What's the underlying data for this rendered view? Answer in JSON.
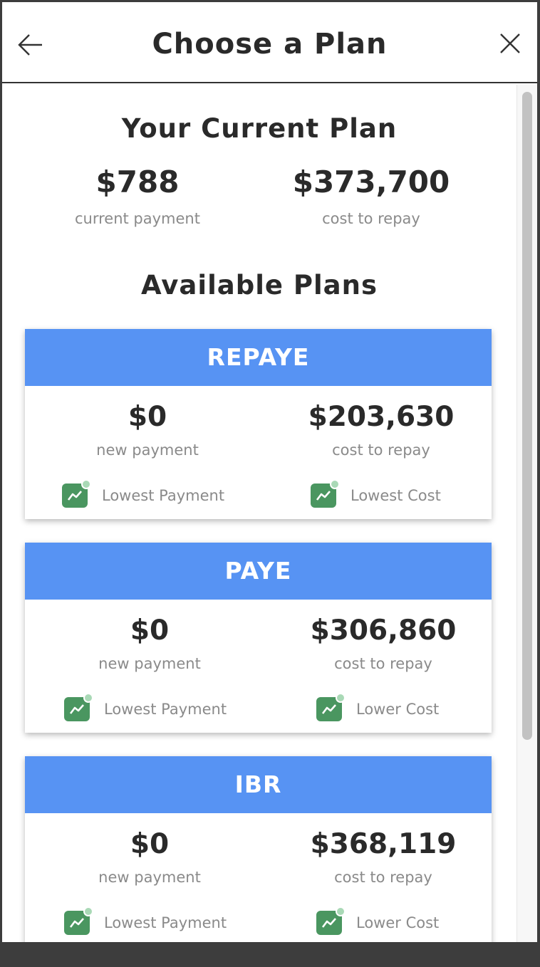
{
  "header": {
    "title": "Choose a Plan",
    "back_icon": "arrow-left-icon",
    "close_icon": "close-icon"
  },
  "current_plan": {
    "title": "Your Current Plan",
    "payment_amount": "$788",
    "payment_label": "current payment",
    "cost_amount": "$373,700",
    "cost_label": "cost to repay"
  },
  "available": {
    "title": "Available Plans",
    "plans": [
      {
        "name": "REPAYE",
        "payment_amount": "$0",
        "payment_label": "new payment",
        "cost_amount": "$203,630",
        "cost_label": "cost to repay",
        "payment_badge": "Lowest Payment",
        "cost_badge": "Lowest Cost"
      },
      {
        "name": "PAYE",
        "payment_amount": "$0",
        "payment_label": "new payment",
        "cost_amount": "$306,860",
        "cost_label": "cost to repay",
        "payment_badge": "Lowest Payment",
        "cost_badge": "Lower Cost"
      },
      {
        "name": "IBR",
        "payment_amount": "$0",
        "payment_label": "new payment",
        "cost_amount": "$368,119",
        "cost_label": "cost to repay",
        "payment_badge": "Lowest Payment",
        "cost_badge": "Lower Cost"
      }
    ]
  },
  "colors": {
    "card_header": "#5793f3",
    "badge_green": "#4a9660",
    "muted_text": "#8a8a8a"
  }
}
